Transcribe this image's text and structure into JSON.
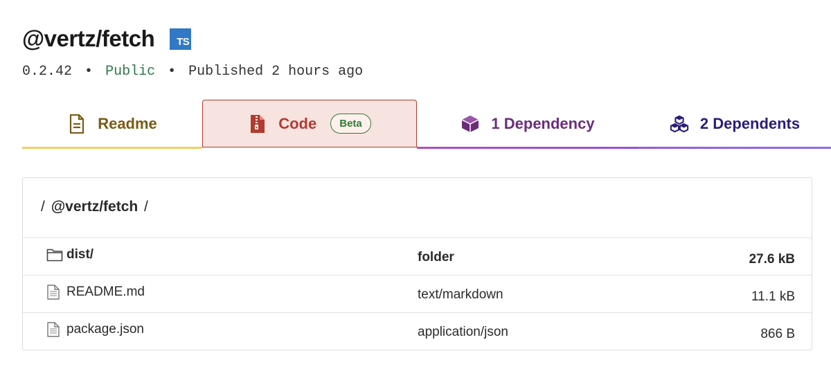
{
  "package": {
    "name": "@vertz/fetch",
    "ts_badge": "TS",
    "version": "0.2.42",
    "visibility": "Public",
    "published": "Published 2 hours ago",
    "separator": "•"
  },
  "tabs": [
    {
      "label": "Readme",
      "icon": "document-icon",
      "color": "#7a5b15"
    },
    {
      "label": "Code",
      "icon": "zip-file-icon",
      "badge": "Beta",
      "color": "#b23b30",
      "active": true
    },
    {
      "label": "1 Dependency",
      "icon": "box-icon",
      "color": "#6b2d7a"
    },
    {
      "label": "2 Dependents",
      "icon": "boxes-icon",
      "color": "#2b1b7a"
    }
  ],
  "browser": {
    "breadcrumb_sep": "/",
    "breadcrumb": "@vertz/fetch",
    "files": [
      {
        "name": "dist/",
        "type": "folder",
        "size": "27.6 kB",
        "icon": "folder-icon"
      },
      {
        "name": "README.md",
        "type": "text/markdown",
        "size": "11.1 kB",
        "icon": "file-icon"
      },
      {
        "name": "package.json",
        "type": "application/json",
        "size": "866 B",
        "icon": "file-icon"
      }
    ]
  },
  "colors": {
    "ts_blue": "#3178c6",
    "public_green": "#2f7a4a",
    "code_red": "#b23b30",
    "readme_yellow": "#f3cf5a"
  }
}
